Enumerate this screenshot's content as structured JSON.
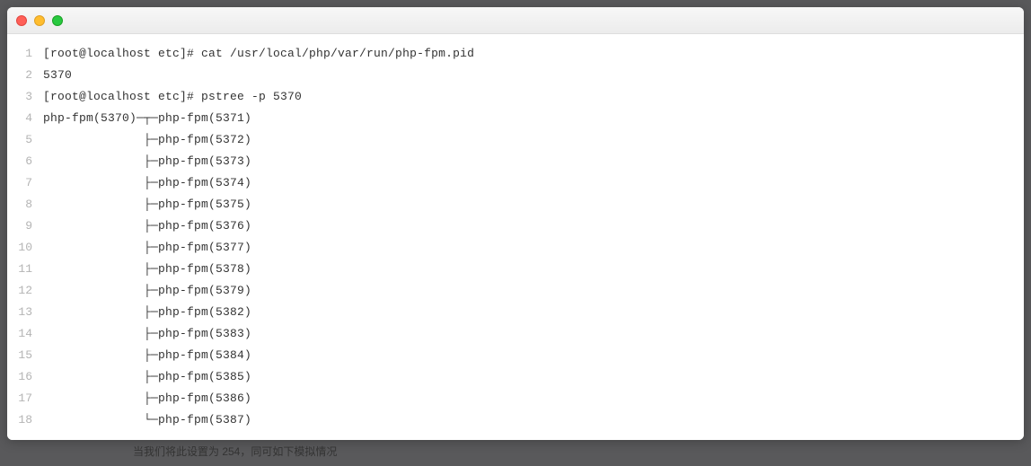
{
  "terminal": {
    "lines": [
      "[root@localhost etc]# cat /usr/local/php/var/run/php-fpm.pid",
      "5370",
      "[root@localhost etc]# pstree -p 5370",
      "php-fpm(5370)─┬─php-fpm(5371)",
      "              ├─php-fpm(5372)",
      "              ├─php-fpm(5373)",
      "              ├─php-fpm(5374)",
      "              ├─php-fpm(5375)",
      "              ├─php-fpm(5376)",
      "              ├─php-fpm(5377)",
      "              ├─php-fpm(5378)",
      "              ├─php-fpm(5379)",
      "              ├─php-fpm(5382)",
      "              ├─php-fpm(5383)",
      "              ├─php-fpm(5384)",
      "              ├─php-fpm(5385)",
      "              ├─php-fpm(5386)",
      "              └─php-fpm(5387)"
    ]
  },
  "caption": "当我们将此设置为 254，同可如下模拟情况"
}
